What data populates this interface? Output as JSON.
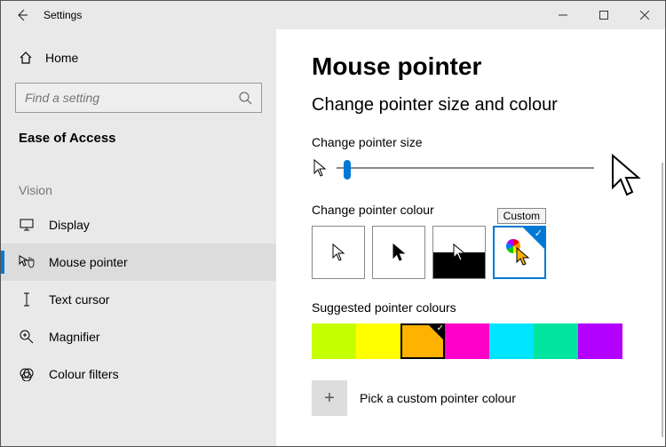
{
  "window": {
    "title": "Settings"
  },
  "sidebar": {
    "home": "Home",
    "search_placeholder": "Find a setting",
    "category": "Ease of Access",
    "group": "Vision",
    "items": [
      {
        "label": "Display"
      },
      {
        "label": "Mouse pointer"
      },
      {
        "label": "Text cursor"
      },
      {
        "label": "Magnifier"
      },
      {
        "label": "Colour filters"
      }
    ]
  },
  "main": {
    "title": "Mouse pointer",
    "subtitle": "Change pointer size and colour",
    "size_label": "Change pointer size",
    "colour_label": "Change pointer colour",
    "tooltip": "Custom",
    "suggested_label": "Suggested pointer colours",
    "swatches": [
      "#c6ff00",
      "#ffff00",
      "#ffb200",
      "#ff00c8",
      "#00e5ff",
      "#00e5a0",
      "#b400ff"
    ],
    "selected_swatch_index": 2,
    "pick_label": "Pick a custom pointer colour"
  }
}
